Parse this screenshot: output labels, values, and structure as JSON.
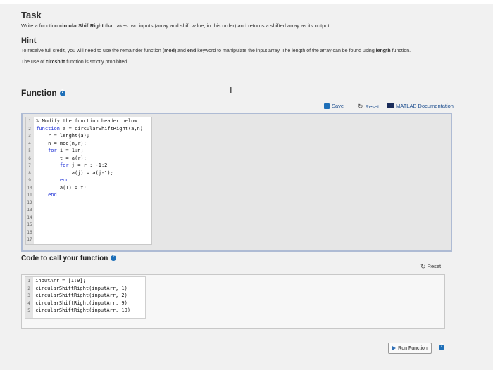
{
  "task": {
    "title": "Task",
    "desc_pre": "Write a function ",
    "desc_fn": "circularShiftRight",
    "desc_post": " that takes two inputs (array and shift value, in this order) and returns a shifted array as its output."
  },
  "hint": {
    "title": "Hint",
    "l1_a": "To receive full credit, you will need to use the remainder function ",
    "l1_b": "(mod)",
    "l1_c": " and ",
    "l1_d": "end",
    "l1_e": " keyword to manipulate the input array. The length of the array can be found using ",
    "l1_f": "length",
    "l1_g": " function.",
    "l2_a": "The use of ",
    "l2_b": "circshift",
    "l2_c": " function is strictly prohibited."
  },
  "function_section": {
    "title": "Function",
    "save_label": "Save",
    "reset_label": "Reset",
    "docs_label": "MATLAB Documentation"
  },
  "editor_lines": [
    {
      "n": "1",
      "text": "% Modify the function header below"
    },
    {
      "n": "2",
      "text": "function a = circularShiftRight(a,n)"
    },
    {
      "n": "3",
      "text": "    r = lenght(a);"
    },
    {
      "n": "4",
      "text": "    n = mod(n,r);"
    },
    {
      "n": "5",
      "text": "    for i = 1:n;"
    },
    {
      "n": "6",
      "text": "        t = a(r);"
    },
    {
      "n": "7",
      "text": "        for j = r : -1:2"
    },
    {
      "n": "8",
      "text": "            a(j) = a(j-1);"
    },
    {
      "n": "9",
      "text": "        end"
    },
    {
      "n": "10",
      "text": "        a(1) = t;"
    },
    {
      "n": "11",
      "text": "    end"
    },
    {
      "n": "12",
      "text": ""
    },
    {
      "n": "13",
      "text": ""
    },
    {
      "n": "14",
      "text": ""
    },
    {
      "n": "15",
      "text": ""
    },
    {
      "n": "16",
      "text": ""
    },
    {
      "n": "17",
      "text": ""
    }
  ],
  "call_section": {
    "title": "Code to call your function",
    "reset_label": "Reset",
    "lines": [
      {
        "n": "1",
        "text": "inputArr = [1:9];"
      },
      {
        "n": "2",
        "text": "circularShiftRight(inputArr, 1)"
      },
      {
        "n": "3",
        "text": "circularShiftRight(inputArr, 2)"
      },
      {
        "n": "4",
        "text": "circularShiftRight(inputArr, 9)"
      },
      {
        "n": "5",
        "text": "circularShiftRight(inputArr, 10)"
      }
    ]
  },
  "run_button": {
    "label": "Run Function"
  }
}
